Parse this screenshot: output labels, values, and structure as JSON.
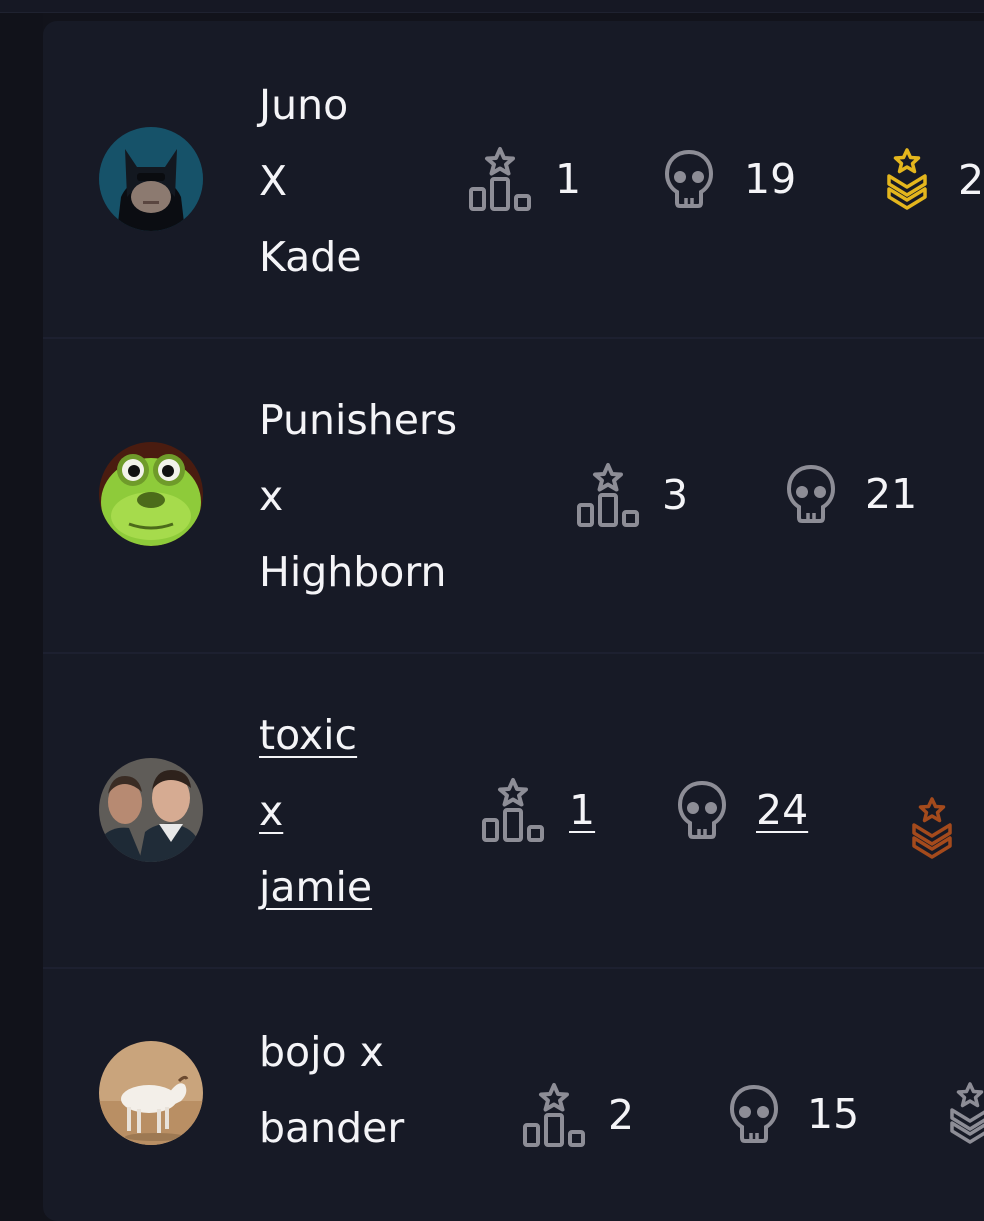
{
  "colors": {
    "page_bg": "#12131b",
    "card_bg": "#171a26",
    "text": "#f4f4f7",
    "icon_gray": "#8d8d96",
    "gold": "#e4b61d",
    "bronze": "#a44a1c"
  },
  "rows": [
    {
      "avatar": "batman-avatar",
      "team_lines": [
        "Juno",
        "X",
        "Kade"
      ],
      "linked": false,
      "placement": "1",
      "kills": "19",
      "rank_icon": "gold-rank-icon",
      "rank_partial": "2"
    },
    {
      "avatar": "frog-avatar",
      "team_lines": [
        "Punishers",
        "x",
        "Highborn"
      ],
      "linked": false,
      "placement": "3",
      "kills": "21",
      "rank_icon": "",
      "rank_partial": ""
    },
    {
      "avatar": "two-men-avatar",
      "team_lines": [
        "toxic",
        "x",
        "jamie"
      ],
      "linked": true,
      "placement": "1",
      "kills": "24",
      "rank_icon": "bronze-rank-icon",
      "rank_partial": ""
    },
    {
      "avatar": "goat-avatar",
      "team_lines": [
        "bojo x",
        "bander"
      ],
      "linked": false,
      "placement": "2",
      "kills": "15",
      "rank_icon": "gray-rank-icon",
      "rank_partial": ""
    }
  ]
}
